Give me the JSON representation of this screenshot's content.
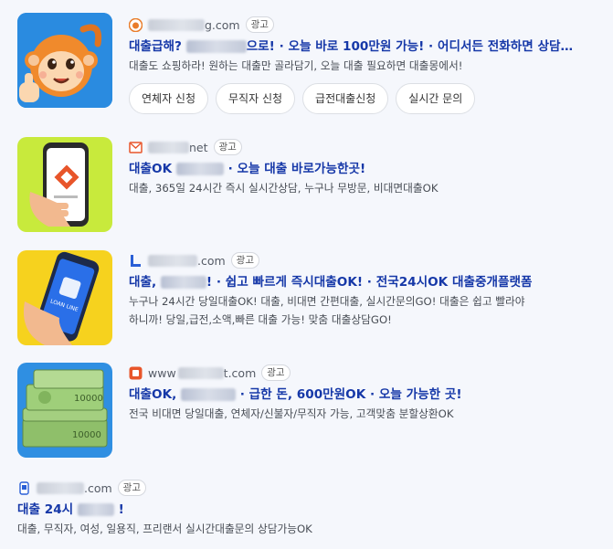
{
  "ads": [
    {
      "domain_suffix": "g.com",
      "badge": "광고",
      "title_prefix": "대출급해?",
      "title_suffix": "으로! · 오늘 바로 100만원 가능! · 어디서든 전화하면 상담…",
      "desc": "대출도 쇼핑하라! 원하는 대출만 골라담기, 오늘 대출 필요하면 대출몽에서!",
      "chips": [
        "연체자 신청",
        "무직자 신청",
        "급전대출신청",
        "실시간 문의"
      ]
    },
    {
      "domain_suffix": "net",
      "badge": "광고",
      "title_prefix": "대출OK",
      "title_suffix": "· 오늘 대출 바로가능한곳!",
      "desc": "대출, 365일 24시간 즉시 실시간상담, 누구나 무방문, 비대면대출OK"
    },
    {
      "domain_suffix": ".com",
      "badge": "광고",
      "title_prefix": "대출,",
      "title_suffix": "! · 쉽고 빠르게 즉시대출OK! · 전국24시OK 대출중개플랫폼",
      "desc_line1": "누구나 24시간 당일대출OK! 대출, 비대면 간편대출, 실시간문의GO! 대출은 쉽고 빨라야",
      "desc_line2": "하니까! 당일,급전,소액,빠른 대출 가능! 맞춤 대출상담GO!"
    },
    {
      "domain_prefix": "www",
      "domain_suffix": "t.com",
      "badge": "광고",
      "title_prefix": "대출OK,",
      "title_suffix": "· 급한 돈, 600만원OK · 오늘 가능한 곳!",
      "desc": "전국 비대면 당일대출, 연체자/신불자/무직자 가능, 고객맞춤 분할상환OK"
    },
    {
      "domain_suffix": ".com",
      "badge": "광고",
      "title_prefix": "대출 24시",
      "title_suffix": "!",
      "desc": "대출, 무직자, 여성, 일용직, 프리랜서 실시간대출문의 상담가능OK"
    }
  ],
  "thumb_text": {
    "loan_line": "LOAN LINE",
    "bill": "10000"
  },
  "colors": {
    "title_link": "#1638a8",
    "background": "#f5f7fc"
  }
}
